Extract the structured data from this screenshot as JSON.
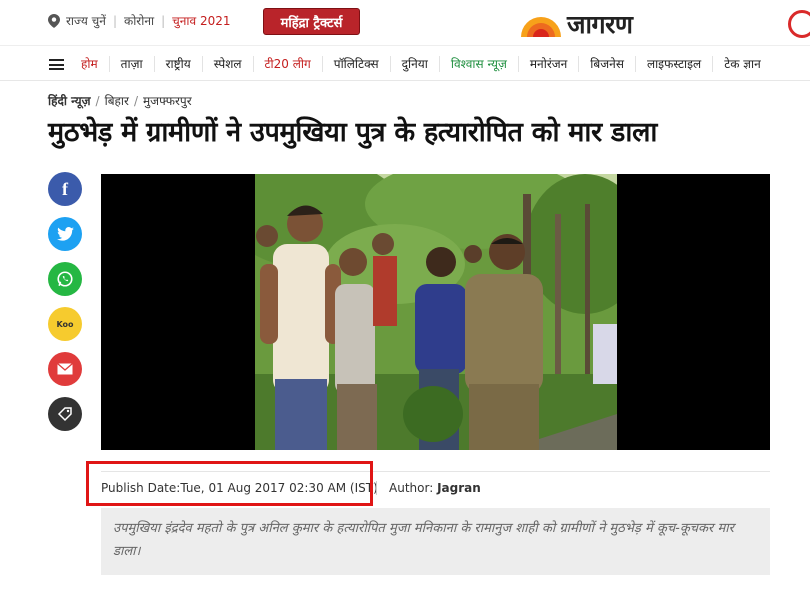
{
  "topbar": {
    "state_elections": "राज्य चुनें",
    "corona": "कोरोना",
    "election": "चुनाव 2021",
    "promo": "महिंद्रा ट्रैक्टर्स",
    "logo_text": "जागरण",
    "colors": {
      "brand_red": "#c41e1e",
      "promo_bg": "#b9242a"
    }
  },
  "nav": {
    "items": [
      {
        "label": "होम"
      },
      {
        "label": "ताज़ा"
      },
      {
        "label": "राष्ट्रीय"
      },
      {
        "label": "स्पेशल"
      },
      {
        "label": "टी20 लीग"
      },
      {
        "label": "पॉलिटिक्स"
      },
      {
        "label": "दुनिया"
      },
      {
        "label": "विश्वास न्यूज़"
      },
      {
        "label": "मनोरंजन"
      },
      {
        "label": "बिजनेस"
      },
      {
        "label": "लाइफस्टाइल"
      },
      {
        "label": "टेक ज्ञान"
      }
    ]
  },
  "breadcrumb": {
    "items": [
      "हिंदी न्यूज़",
      "बिहार",
      "मुजफ्फरपुर"
    ]
  },
  "article": {
    "title": "मुठभेड़ में ग्रामीणों ने उपमुखिया पुत्र के हत्यारोपित को मार डाला",
    "publish_date": "Publish Date:Tue, 01 Aug 2017 02:30 AM (IST)",
    "author_label": "Author:",
    "author": "Jagran",
    "summary": "उपमुखिया इंद्रदेव महतो के पुत्र अनिल कुमार के हत्यारोपित मुजा मनिकाना के रामानुज शाही को ग्रामीणों ने मुठभेड़ में कूच-कूचकर मार डाला।"
  },
  "share": {
    "icons": [
      "facebook-icon",
      "twitter-icon",
      "whatsapp-icon",
      "koo-icon",
      "mail-icon",
      "tag-icon"
    ],
    "koo_label": "Koo"
  }
}
